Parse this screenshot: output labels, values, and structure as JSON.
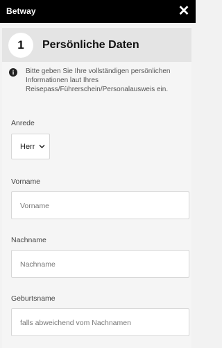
{
  "topbar": {
    "brand": "Betway",
    "close_glyph": "✕"
  },
  "step": {
    "number": "1",
    "title": "Persönliche Daten"
  },
  "info": {
    "icon": "info-icon",
    "text": "Bitte geben Sie Ihre vollständigen persönlichen Informationen laut Ihres Reisepass/Führerschein/Personalausweis ein."
  },
  "form": {
    "salutation": {
      "label": "Anrede",
      "value": "Herr"
    },
    "first_name": {
      "label": "Vorname",
      "placeholder": "Vorname"
    },
    "last_name": {
      "label": "Nachname",
      "placeholder": "Nachname"
    },
    "birth_name": {
      "label": "Geburtsname",
      "placeholder": "falls abweichend vom Nachnamen"
    }
  },
  "colors": {
    "topbar": "#000000",
    "header": "#e4e4e4",
    "background": "#f2f2f2"
  }
}
